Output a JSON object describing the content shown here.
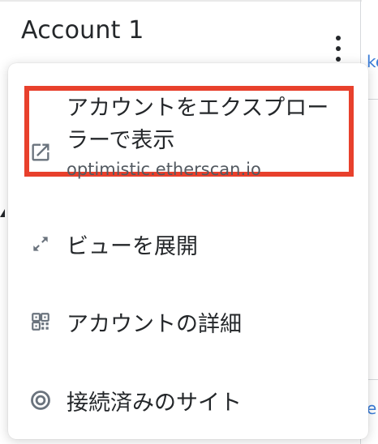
{
  "header": {
    "account_name": "Account 1"
  },
  "background": {
    "edge_text_top": "ke",
    "edge_text_bottom": "e"
  },
  "menu": {
    "items": [
      {
        "label": "アカウントをエクスプローラーで表示",
        "sublabel": "optimistic.etherscan.io",
        "icon": "external-link-icon",
        "highlighted": true,
        "highlight_color": "#e8402c"
      },
      {
        "label": "ビューを展開",
        "icon": "expand-icon"
      },
      {
        "label": "アカウントの詳細",
        "icon": "qr-code-icon"
      },
      {
        "label": "接続済みのサイト",
        "icon": "connected-sites-icon"
      }
    ]
  },
  "colors": {
    "text": "#24272a",
    "muted": "#535a61",
    "icon": "#6a737d",
    "link": "#3b7dd8"
  }
}
